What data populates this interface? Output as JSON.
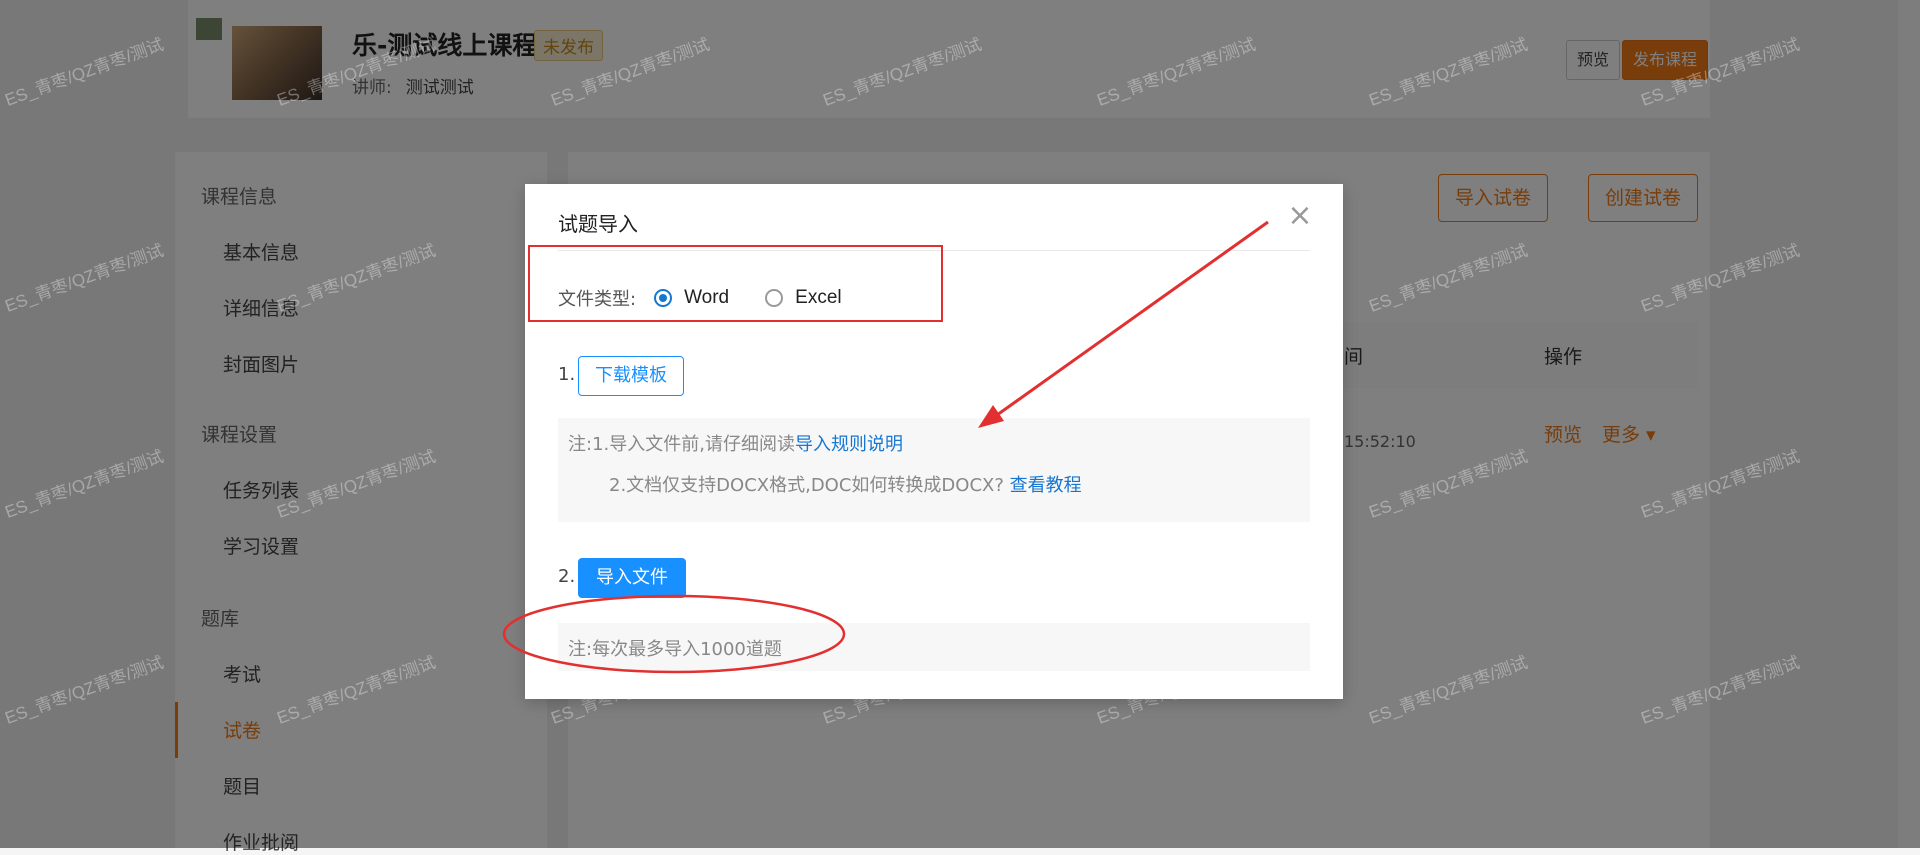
{
  "header": {
    "course_title": "乐-测试线上课程",
    "status_badge": "未发布",
    "teacher_label": "讲师:",
    "teacher_name": "测试测试",
    "preview_label": "预览",
    "publish_label": "发布课程"
  },
  "sidebar": {
    "groups": [
      {
        "label": "课程信息",
        "items": [
          "基本信息",
          "详细信息",
          "封面图片"
        ]
      },
      {
        "label": "课程设置",
        "items": [
          "任务列表",
          "学习设置"
        ]
      },
      {
        "label": "题库",
        "items": [
          "考试",
          "试卷",
          "题目",
          "作业批阅"
        ]
      }
    ],
    "active_item": "试卷"
  },
  "main": {
    "import_exam_label": "导入试卷",
    "create_exam_label": "创建试卷",
    "column_time": "间",
    "column_actions": "操作",
    "row_time": "15:52:10",
    "row_preview": "预览",
    "row_more": "更多 ▾"
  },
  "modal": {
    "title": "试题导入",
    "close_icon": "×",
    "file_type_label": "文件类型:",
    "options": [
      {
        "label": "Word",
        "checked": true
      },
      {
        "label": "Excel",
        "checked": false
      }
    ],
    "step1_number": "1.",
    "download_template_label": "下载模板",
    "note1_prefix": "注:1.导入文件前,请仔细阅读",
    "note1_link": "导入规则说明",
    "note2_text": "2.文档仅支持DOCX格式,DOC如何转换成DOCX?",
    "note2_link": "查看教程",
    "step2_number": "2.",
    "import_file_label": "导入文件",
    "limit_note": "注:每次最多导入1000道题"
  },
  "watermark_text": "ES_青枣/QZ青枣/测试",
  "colors": {
    "accent_orange": "#f07a14",
    "primary_blue": "#1890ff",
    "annotation_red": "#e23030"
  }
}
